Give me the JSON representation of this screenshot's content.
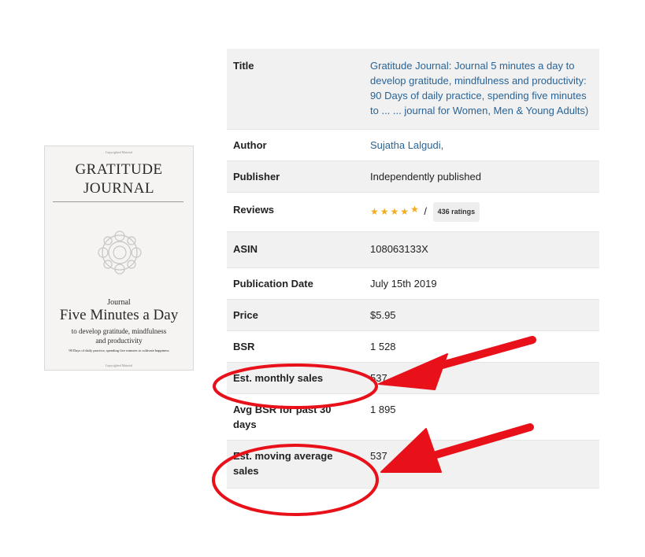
{
  "cover": {
    "top_small": "Copyrighted Material",
    "title": "GRATITUDE JOURNAL",
    "subtitle_small": "Journal",
    "subtitle_main": "Five Minutes a Day",
    "subtitle_desc": "to develop gratitude, mindfulness and productivity",
    "footer_desc": "90 Days of daily practice, spending five minutes to cultivate happiness",
    "bottom_small": "Copyrighted Material"
  },
  "details": {
    "title_label": "Title",
    "title_value": "Gratitude Journal: Journal 5 minutes a day to develop gratitude, mindfulness and productivity: 90 Days of daily practice, spending five minutes to ... ... journal for Women, Men & Young Adults)",
    "author_label": "Author",
    "author_value": "Sujatha Lalgudi,",
    "publisher_label": "Publisher",
    "publisher_value": "Independently published",
    "reviews_label": "Reviews",
    "rating": 4.5,
    "ratings_badge": "436 ratings",
    "asin_label": "ASIN",
    "asin_value": "108063133X",
    "pubdate_label": "Publication Date",
    "pubdate_value": "July 15th 2019",
    "price_label": "Price",
    "price_value": "$5.95",
    "bsr_label": "BSR",
    "bsr_value": "1 528",
    "monthly_label": "Est. monthly sales",
    "monthly_value": "537",
    "avgbsr_label": "Avg BSR for past 30 days",
    "avgbsr_value": "1 895",
    "moving_label": "Est. moving average sales",
    "moving_value": "537"
  },
  "colors": {
    "link": "#2a6496",
    "star": "#f0ad1e",
    "annotation": "#e8111a",
    "row_shade": "#f1f1f1"
  }
}
